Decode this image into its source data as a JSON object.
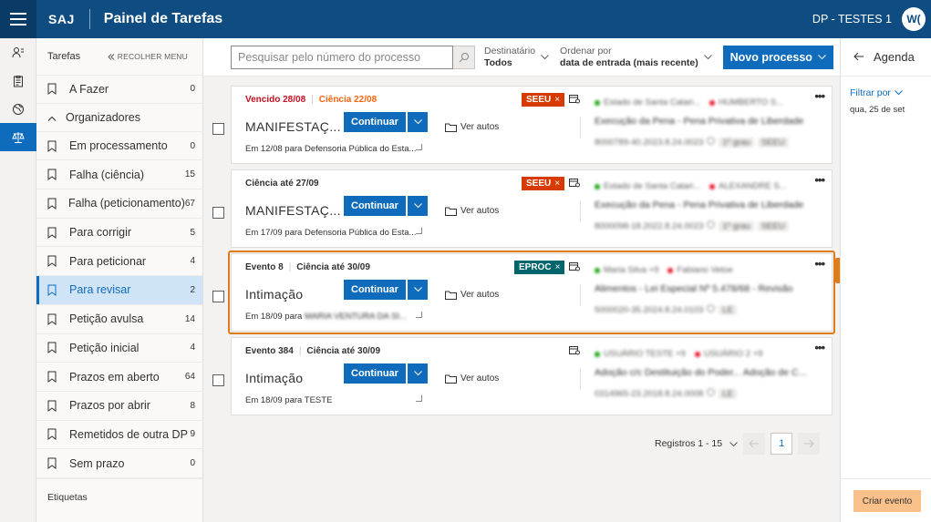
{
  "header": {
    "brand": "SAJ",
    "title": "Painel de Tarefas",
    "user": "DP - TESTES 1",
    "avatar": "W("
  },
  "sidebar": {
    "title": "Tarefas",
    "collapse": "RECOLHER MENU",
    "afazer": {
      "label": "A Fazer",
      "count": "0"
    },
    "group": "Organizadores",
    "items": [
      {
        "label": "Em processamento",
        "count": "0"
      },
      {
        "label": "Falha (ciência)",
        "count": "15"
      },
      {
        "label": "Falha (peticionamento)",
        "count": "67"
      },
      {
        "label": "Para corrigir",
        "count": "5"
      },
      {
        "label": "Para peticionar",
        "count": "4"
      },
      {
        "label": "Para revisar",
        "count": "2"
      },
      {
        "label": "Petição avulsa",
        "count": "14"
      },
      {
        "label": "Petição inicial",
        "count": "4"
      },
      {
        "label": "Prazos em aberto",
        "count": "64"
      },
      {
        "label": "Prazos por abrir",
        "count": "8"
      },
      {
        "label": "Remetidos de outra DP",
        "count": "9"
      },
      {
        "label": "Sem prazo",
        "count": "0"
      }
    ],
    "footer": "Etiquetas"
  },
  "toolbar": {
    "search_placeholder": "Pesquisar pelo número do processo",
    "dest_label": "Destinatário",
    "dest_value": "Todos",
    "order_label": "Ordenar por",
    "order_value": "data de entrada (mais recente)",
    "new_button": "Novo processo"
  },
  "cards": [
    {
      "top1": "Vencido 28/08",
      "top2": "Ciência 22/08",
      "tag": "SEEU",
      "title": "MANIFESTAÇ...",
      "continue": "Continuar",
      "ver": "Ver autos",
      "sub": "Em 12/08 para Defensoria Pública do Esta...",
      "l1a": "Estado de Santa Catari...",
      "l1b": "HUMBERTO S...",
      "l2": "Execução da Pena - Pena Privativa de Liberdade",
      "l3": "8000789-40.2023.8.24.0023",
      "l3p1": "1º grau",
      "l3p2": "SEEU"
    },
    {
      "top1": "Ciência até 27/09",
      "tag": "SEEU",
      "title": "MANIFESTAÇ...",
      "continue": "Continuar",
      "ver": "Ver autos",
      "sub": "Em 17/09 para Defensoria Pública do Esta...",
      "l1a": "Estado de Santa Catari...",
      "l1b": "ALEXANDRE S...",
      "l2": "Execução da Pena - Pena Privativa de Liberdade",
      "l3": "8000098-18.2022.8.24.0023",
      "l3p1": "1º grau",
      "l3p2": "SEEU"
    },
    {
      "top1": "Evento 8",
      "top2": "Ciência até 30/09",
      "tag": "EPROC",
      "title": "Intimação",
      "continue": "Continuar",
      "ver": "Ver autos",
      "sub": "Em 18/09 para",
      "subblur": "MARIA VENTURA DA SI...",
      "l1a": "Maria Silva +9",
      "l1b": "Fabiano Vetoe",
      "l2": "Alimentos - Lei Especial Nº 5.478/68 - Revisão",
      "l3": "5000020-35.2024.8.24.0103",
      "l3p1": "LE"
    },
    {
      "top1": "Evento 384",
      "top2": "Ciência até 30/09",
      "title": "Intimação",
      "continue": "Continuar",
      "ver": "Ver autos",
      "sub": "Em 18/09 para TESTE",
      "l1a": "USUÁRIO TESTE +9",
      "l1b": "USUÁRIO 2 +9",
      "l2": "Adoção c/c Destituição do Poder... Adoção de C...",
      "l3": "0314965-23.2018.8.24.0008",
      "l3p1": "LE"
    }
  ],
  "highlight": "1",
  "pager": {
    "label": "Registros 1 - 15",
    "page": "1"
  },
  "agenda": {
    "title": "Agenda",
    "filter": "Filtrar por",
    "date": "qua, 25 de set",
    "button": "Criar evento"
  }
}
